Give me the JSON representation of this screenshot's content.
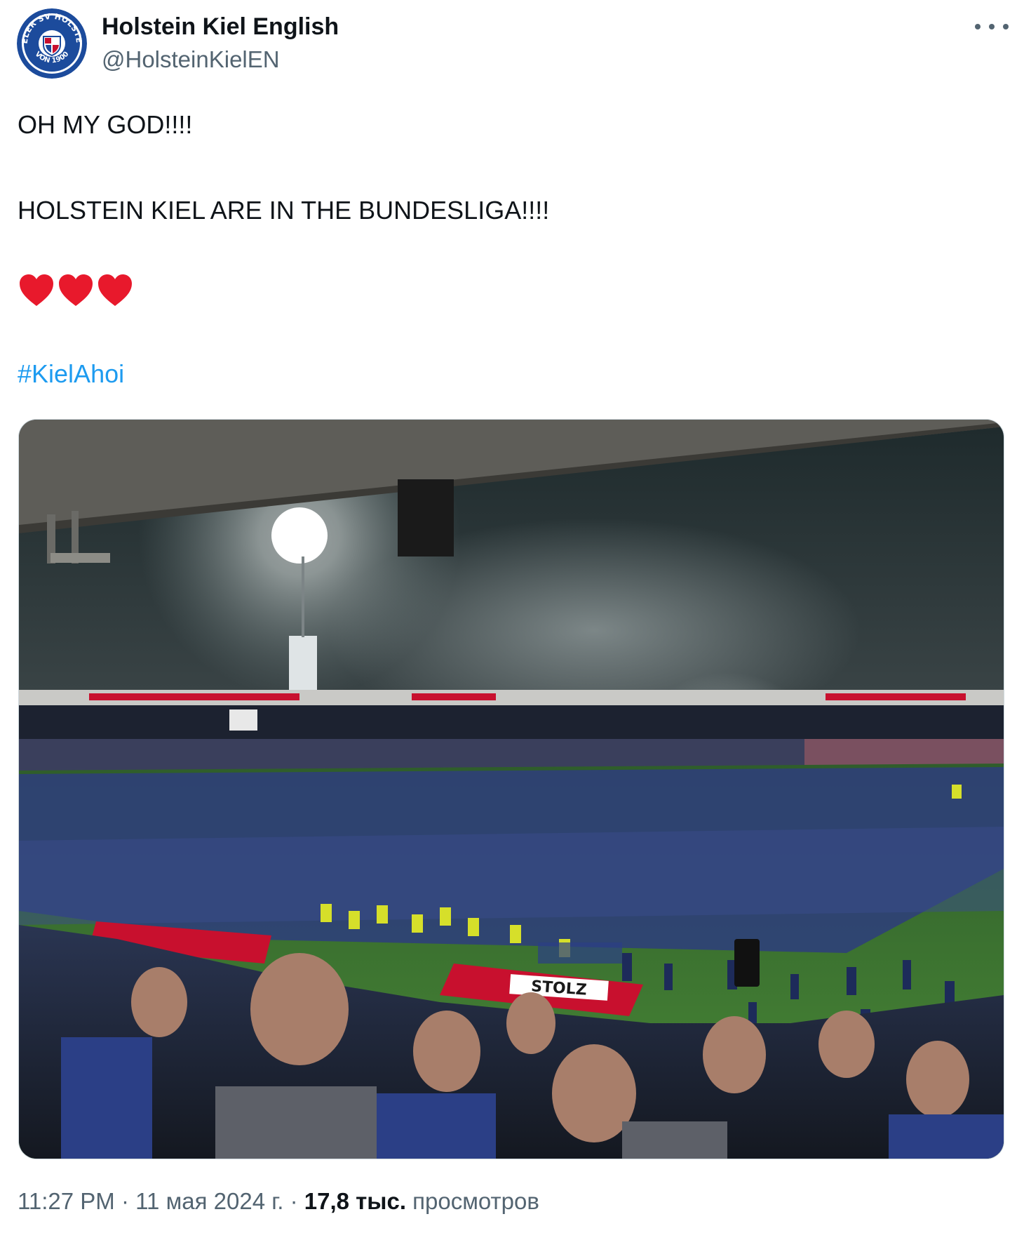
{
  "author": {
    "name": "Holstein Kiel English",
    "handle": "@HolsteinKielEN",
    "avatar_text": "KIELER SV HOLSTEIN VON 1900"
  },
  "tweet": {
    "line1": "OH MY GOD!!!!",
    "line2": "HOLSTEIN KIEL ARE IN THE BUNDESLIGA!!!!",
    "emoji": "❤️❤️❤️",
    "hashtag": "#KielAhoi"
  },
  "media": {
    "ad_text": "STOLZ"
  },
  "meta": {
    "time": "11:27 PM",
    "separator": " · ",
    "date": "11 мая 2024 г.",
    "views_count": "17,8 тыс.",
    "views_label": " просмотров"
  },
  "colors": {
    "link": "#1d9bf0",
    "secondary": "#536471",
    "heart": "#e8192c",
    "club_blue": "#1c4b9c"
  },
  "icons": [
    "more-icon",
    "heart-icon",
    "club-logo"
  ]
}
